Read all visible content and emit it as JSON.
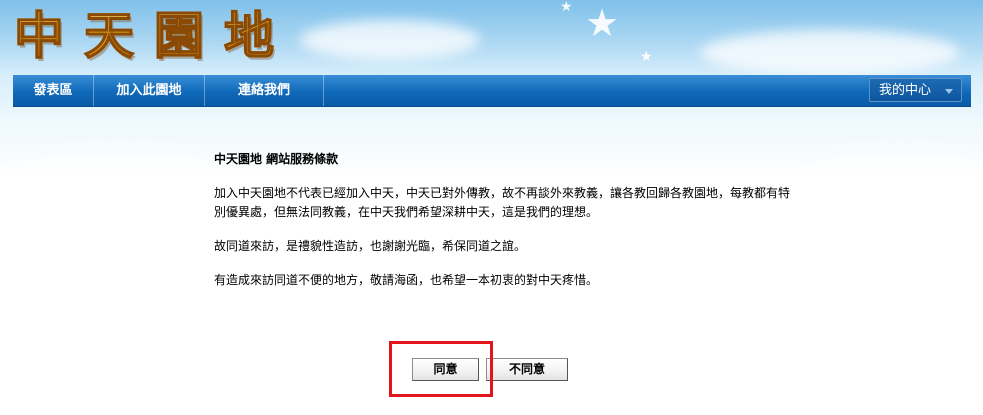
{
  "site": {
    "logo_chars": [
      "中",
      "天",
      "園",
      "地"
    ]
  },
  "navbar": {
    "items": [
      {
        "label": "發表區"
      },
      {
        "label": "加入此園地"
      },
      {
        "label": "連絡我們"
      }
    ],
    "my_center_label": "我的中心"
  },
  "terms": {
    "title": "中天園地 網站服務條款",
    "paragraphs": [
      "加入中天園地不代表已經加入中天，中天已對外傳教，故不再談外來教義，讓各教回歸各教園地，每教都有特別優異處，但無法同教義，在中天我們希望深耕中天，這是我們的理想。",
      "故同道來訪，是禮貌性造訪，也謝謝光臨，希保同道之誼。",
      "有造成來訪同道不便的地方，敬請海函，也希望一本初衷的對中天疼惜。"
    ]
  },
  "buttons": {
    "agree_label": "同意",
    "disagree_label": "不同意"
  },
  "colors": {
    "nav_blue": "#0f69b9",
    "highlight_red": "#e3141a",
    "logo_gold": "#f3b21e"
  }
}
